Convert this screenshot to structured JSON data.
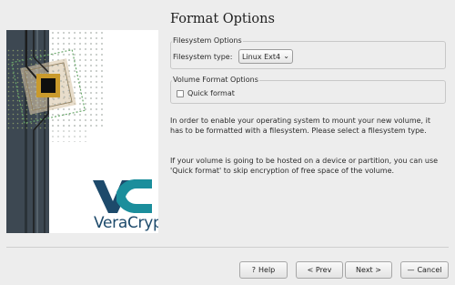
{
  "page_title": "Format Options",
  "brand": {
    "name": "VeraCrypt"
  },
  "filesystem_group": {
    "legend": "Filesystem Options",
    "type_label": "Filesystem type:",
    "type_value": "Linux Ext4"
  },
  "volume_group": {
    "legend": "Volume Format Options",
    "quick_format_label": "Quick format",
    "quick_format_checked": false
  },
  "info": {
    "p1": "In order to enable your operating system to mount your new volume, it has to be formatted with a filesystem. Please select a filesystem type.",
    "p2": "If your volume is going to be hosted on a device or partition, you can use 'Quick format' to skip encryption of free space of the volume."
  },
  "buttons": {
    "help": "Help",
    "prev": "< Prev",
    "next": "Next >",
    "cancel": "Cancel"
  },
  "icons": {
    "help": "help-icon",
    "cancel": "cancel-icon",
    "dropdown": "chevron-down-icon"
  },
  "colors": {
    "brand_blue": "#1d4a6b",
    "logo_teal": "#1b8e9c",
    "banner_dark": "#3d4852"
  }
}
